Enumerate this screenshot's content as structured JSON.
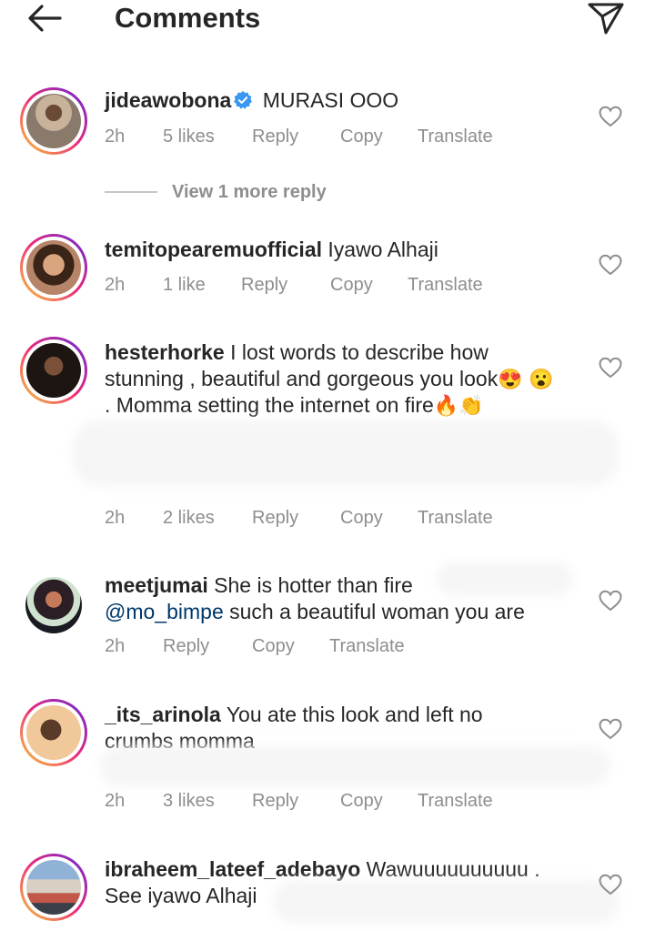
{
  "header": {
    "title": "Comments",
    "back_icon": "arrow-left-icon",
    "send_icon": "paper-plane-icon"
  },
  "comments": [
    {
      "username": "jideawobona",
      "verified": true,
      "text": "MURASI OOO",
      "time": "2h",
      "likes": "5 likes",
      "reply": "Reply",
      "copy": "Copy",
      "translate": "Translate",
      "view_more": "View 1 more reply"
    },
    {
      "username": "temitopearemuofficial",
      "text": "Iyawo Alhaji",
      "time": "2h",
      "likes": "1 like",
      "reply": "Reply",
      "copy": "Copy",
      "translate": "Translate"
    },
    {
      "username": "hesterhorke",
      "text_1": "I lost words to describe how stunning , beautiful and gorgeous you look",
      "emoji_1": "😍",
      "emoji_2": "😮",
      "text_2": ". Momma setting the internet on fire",
      "emoji_3": "🔥",
      "emoji_4": "👏",
      "time": "2h",
      "likes": "2 likes",
      "reply": "Reply",
      "copy": "Copy",
      "translate": "Translate"
    },
    {
      "username": "meetjumai",
      "text": "She is hotter than fire",
      "mention": "@mo_bimpe",
      "text_2": "such a beautiful woman you are",
      "time": "2h",
      "reply": "Reply",
      "copy": "Copy",
      "translate": "Translate"
    },
    {
      "username": "_its_arinola",
      "text": "You ate this look and left no crumbs momma",
      "time": "2h",
      "likes": "3 likes",
      "reply": "Reply",
      "copy": "Copy",
      "translate": "Translate"
    },
    {
      "username": "ibraheem_lateef_adebayo",
      "text": "Wawuuuuuuuuuu . See iyawo Alhaji"
    }
  ]
}
